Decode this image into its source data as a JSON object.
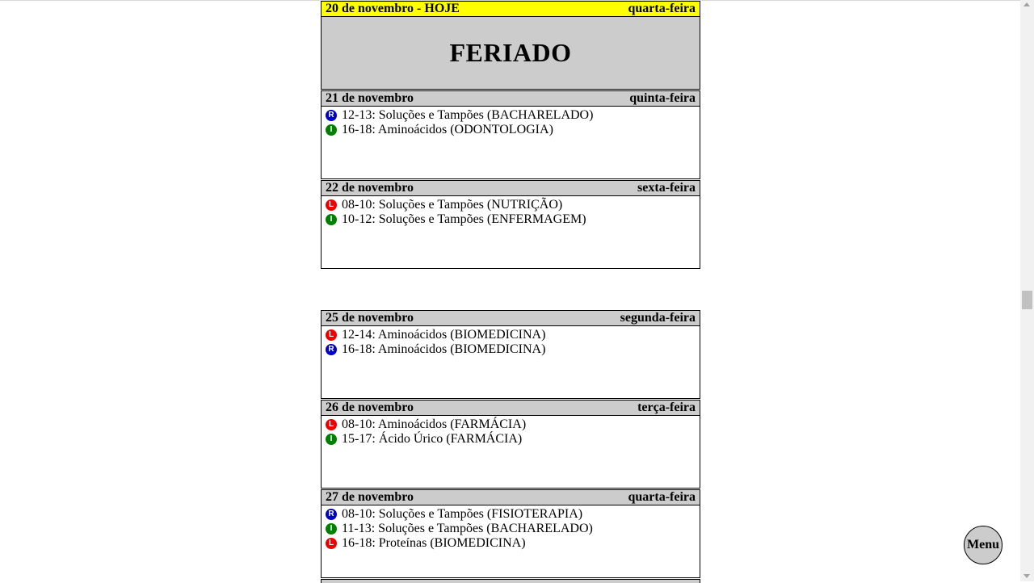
{
  "colors": {
    "lecture": "#0000cc",
    "lab": "#ee0000",
    "individual": "#008000",
    "today": "#ffff00",
    "header": "#cccccc"
  },
  "days": [
    {
      "date": "20 de novembro - HOJE",
      "weekday": "quarta-feira",
      "today": true,
      "holiday": "FERIADO"
    },
    {
      "date": "21 de novembro",
      "weekday": "quinta-feira",
      "events": [
        {
          "badge": "R",
          "text": "12-13: Soluções e Tampões (BACHARELADO)"
        },
        {
          "badge": "I",
          "text": "16-18: Aminoácidos (ODONTOLOGIA)"
        }
      ]
    },
    {
      "date": "22 de novembro",
      "weekday": "sexta-feira",
      "events": [
        {
          "badge": "L",
          "text": "08-10: Soluções e Tampões (NUTRIÇÃO)"
        },
        {
          "badge": "I",
          "text": "10-12: Soluções e Tampões (ENFERMAGEM)"
        }
      ]
    },
    {
      "date": "25 de novembro",
      "weekday": "segunda-feira",
      "events": [
        {
          "badge": "L",
          "text": "12-14: Aminoácidos (BIOMEDICINA)"
        },
        {
          "badge": "R",
          "text": "16-18: Aminoácidos (BIOMEDICINA)"
        }
      ]
    },
    {
      "date": "26 de novembro",
      "weekday": "terça-feira",
      "events": [
        {
          "badge": "L",
          "text": "08-10: Aminoácidos (FARMÁCIA)"
        },
        {
          "badge": "I",
          "text": "15-17: Ácido Úrico (FARMÁCIA)"
        }
      ]
    },
    {
      "date": "27 de novembro",
      "weekday": "quarta-feira",
      "events": [
        {
          "badge": "R",
          "text": "08-10: Soluções e Tampões (FISIOTERAPIA)"
        },
        {
          "badge": "I",
          "text": "11-13: Soluções e Tampões (BACHARELADO)"
        },
        {
          "badge": "L",
          "text": "16-18: Proteínas (BIOMEDICINA)"
        }
      ]
    }
  ],
  "menu": {
    "label": "Menu"
  }
}
